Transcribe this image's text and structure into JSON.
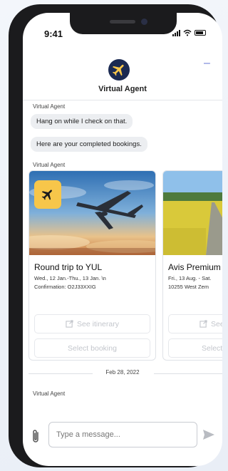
{
  "status_bar": {
    "time": "9:41"
  },
  "header": {
    "title": "Virtual Agent",
    "close_symbol": "–",
    "logo_icon": "airplane-logo-icon"
  },
  "messages": [
    {
      "sender": "Virtual Agent",
      "text": "Hang on while I check on that."
    },
    {
      "text": "Here are your completed bookings."
    }
  ],
  "cards_sender": "Virtual Agent",
  "cards": [
    {
      "title": "Round trip to YUL",
      "line1": "Wed., 12 Jan.-Thu., 13 Jan. \\n",
      "line2": "Confirmation: O2J33XXIG",
      "badge_icon": "airplane-icon",
      "itinerary_label": "See itinerary",
      "select_label": "Select booking"
    },
    {
      "title": "Avis Premium",
      "line1": "Fri., 13 Aug. - Sat.",
      "line2": "10255 West Zem",
      "itinerary_label": "See itinerary",
      "select_label": "Select booking"
    }
  ],
  "date_separator": "Feb 28, 2022",
  "last_sender": "Virtual Agent",
  "composer": {
    "placeholder": "Type a message...",
    "attach_icon": "paperclip-icon",
    "send_icon": "send-icon"
  },
  "colors": {
    "accent": "#f7c64a",
    "logo_bg": "#1b2a52",
    "bubble_bg": "#eceef1",
    "disabled_text": "#c3c6cc"
  }
}
